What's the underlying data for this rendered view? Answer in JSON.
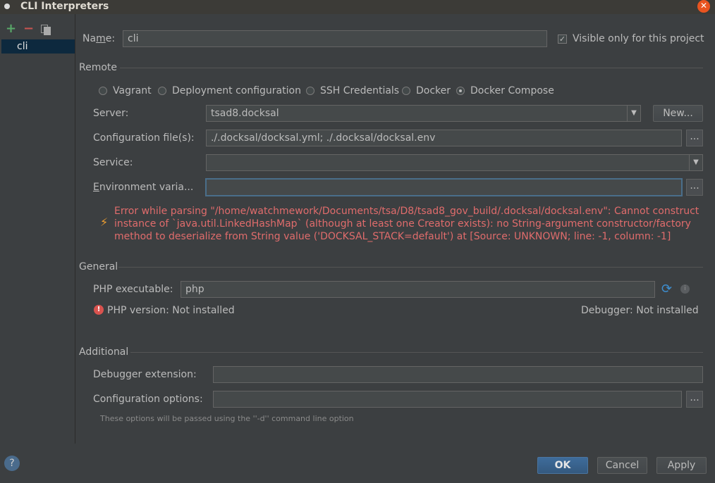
{
  "window": {
    "title": "CLI Interpreters"
  },
  "left_panel": {
    "add_label": "+",
    "remove_label": "−",
    "items": [
      {
        "label": "cli"
      }
    ]
  },
  "name": {
    "label": "Name:",
    "value": "cli"
  },
  "visible_only": {
    "label": "Visible only for this project",
    "checked": true
  },
  "remote": {
    "title": "Remote",
    "options": [
      {
        "label": "Vagrant",
        "checked": false
      },
      {
        "label": "Deployment configuration",
        "checked": false
      },
      {
        "label": "SSH Credentials",
        "checked": false
      },
      {
        "label": "Docker",
        "checked": false
      },
      {
        "label": "Docker Compose",
        "checked": true
      }
    ],
    "server": {
      "label": "Server:",
      "value": "tsad8.docksal",
      "new_button": "New..."
    },
    "config_files": {
      "label": "Configuration file(s):",
      "value": "./.docksal/docksal.yml; ./.docksal/docksal.env",
      "browse": "..."
    },
    "service": {
      "label": "Service:",
      "value": ""
    },
    "env_vars": {
      "label": "Environment varia...",
      "value": "",
      "browse": "..."
    },
    "error": {
      "line1": "Error while parsing \"/home/watchmework/Documents/tsa/D8/tsad8_gov_build/.docksal/docksal.env\": Cannot construct",
      "line2": "instance of `java.util.LinkedHashMap` (although at least one Creator exists): no String-argument constructor/factory",
      "line3": "method to deserialize from String value ('DOCKSAL_STACK=default') at [Source: UNKNOWN; line: -1, column: -1]"
    }
  },
  "general": {
    "title": "General",
    "php_exec": {
      "label": "PHP executable:",
      "value": "php"
    },
    "php_version": "PHP version: Not installed",
    "debugger": "Debugger:  Not installed"
  },
  "additional": {
    "title": "Additional",
    "debugger_ext": {
      "label": "Debugger extension:",
      "value": ""
    },
    "config_options": {
      "label": "Configuration options:",
      "value": "",
      "browse": "..."
    },
    "hint": "These options will be passed using the ''-d'' command line option"
  },
  "footer": {
    "help": "?",
    "ok": "OK",
    "cancel": "Cancel",
    "apply": "Apply"
  },
  "colors": {
    "accent": "#3e6c9b",
    "error": "#e06c6c",
    "selection": "#0d293e"
  }
}
